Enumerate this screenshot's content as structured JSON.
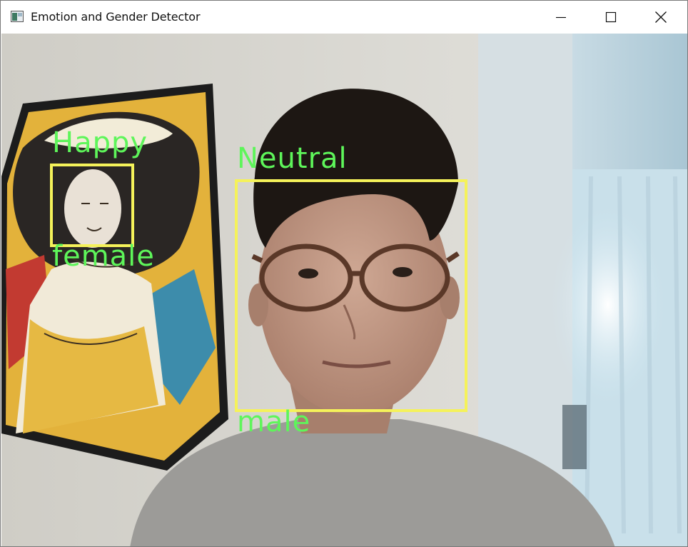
{
  "window": {
    "title": "Emotion and Gender Detector",
    "controls": {
      "minimize": "minimize-icon",
      "maximize": "maximize-icon",
      "close": "close-icon"
    }
  },
  "colors": {
    "label_text": "#5ef55a",
    "box_outline": "#f5f25a"
  },
  "detections": [
    {
      "emotion": "Happy",
      "gender": "female"
    },
    {
      "emotion": "Neutral",
      "gender": "male"
    }
  ]
}
